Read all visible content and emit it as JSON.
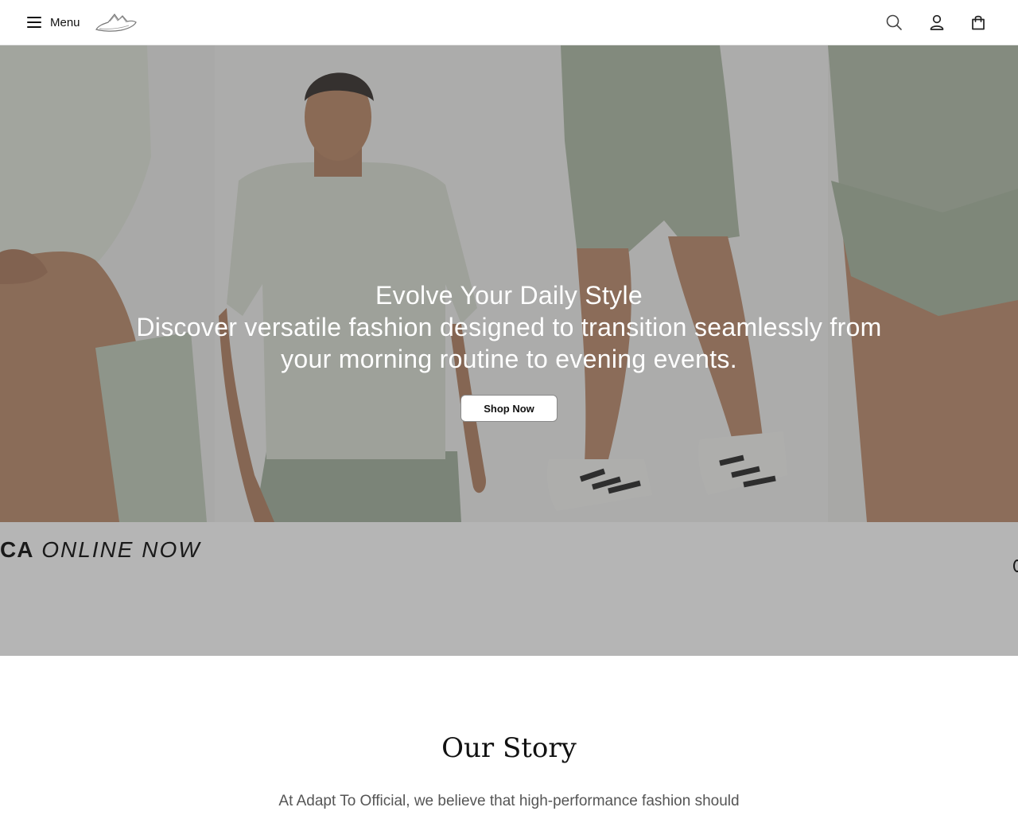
{
  "header": {
    "menu_label": "Menu",
    "icons": [
      "search-icon",
      "account-icon",
      "bag-icon"
    ]
  },
  "hero": {
    "title": "Evolve Your Daily Style",
    "subtitle": "Discover versatile fashion designed to transition seamlessly from your morning routine to evening events.",
    "cta_label": "Shop Now",
    "marquee_bold": "CA",
    "marquee_text": "ONLINE NOW"
  },
  "story": {
    "title": "Our Story",
    "text": "At Adapt To Official, we believe that high-performance fashion should"
  },
  "colors": {
    "overlay": "#464646",
    "button_bg": "#ffffff",
    "text_dark": "#111111",
    "story_text": "#555555"
  }
}
